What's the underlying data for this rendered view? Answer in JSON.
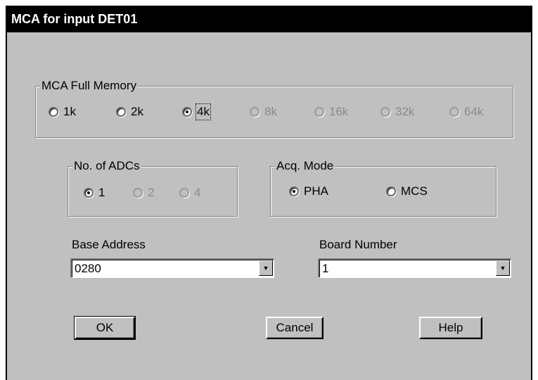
{
  "window": {
    "title": "MCA for input DET01"
  },
  "memory_group": {
    "label": "MCA Full Memory",
    "options": [
      {
        "label": "1k",
        "checked": false,
        "enabled": true
      },
      {
        "label": "2k",
        "checked": false,
        "enabled": true
      },
      {
        "label": "4k",
        "checked": true,
        "enabled": true
      },
      {
        "label": "8k",
        "checked": false,
        "enabled": false
      },
      {
        "label": "16k",
        "checked": false,
        "enabled": false
      },
      {
        "label": "32k",
        "checked": false,
        "enabled": false
      },
      {
        "label": "64k",
        "checked": false,
        "enabled": false
      }
    ]
  },
  "adcs_group": {
    "label": "No. of ADCs",
    "options": [
      {
        "label": "1",
        "checked": true,
        "enabled": true
      },
      {
        "label": "2",
        "checked": false,
        "enabled": false
      },
      {
        "label": "4",
        "checked": false,
        "enabled": false
      }
    ]
  },
  "acq_group": {
    "label": "Acq. Mode",
    "options": [
      {
        "label": "PHA",
        "checked": true,
        "enabled": true
      },
      {
        "label": "MCS",
        "checked": false,
        "enabled": true
      }
    ]
  },
  "base_address": {
    "label": "Base Address",
    "value": "0280"
  },
  "board_number": {
    "label": "Board Number",
    "value": "1"
  },
  "buttons": {
    "ok": "OK",
    "cancel": "Cancel",
    "help": "Help"
  }
}
